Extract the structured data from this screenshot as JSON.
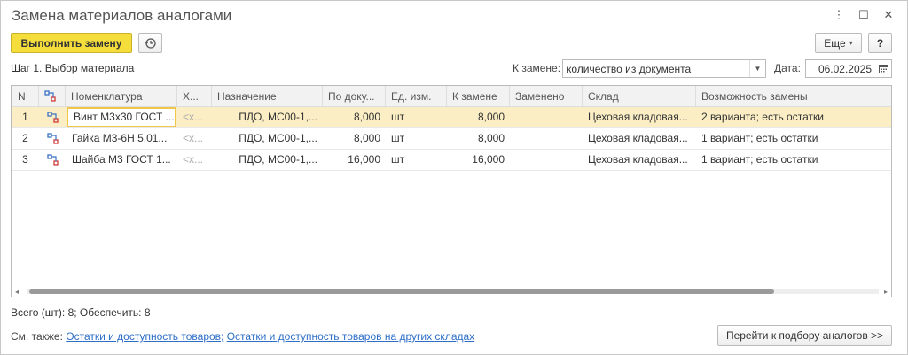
{
  "window": {
    "title": "Замена материалов аналогами",
    "controls": {
      "menu": "⋮",
      "maximize": "☐",
      "close": "✕"
    }
  },
  "toolbar": {
    "execute_label": "Выполнить замену",
    "more_label": "Еще",
    "help_label": "?"
  },
  "step_label": "Шаг 1. Выбор материала",
  "replace": {
    "label": "К замене:",
    "value": "количество из документа"
  },
  "date": {
    "label": "Дата:",
    "value": "06.02.2025"
  },
  "table": {
    "columns": [
      "N",
      "",
      "Номенклатура",
      "Х...",
      "Назначение",
      "По доку...",
      "Ед. изм.",
      "К замене",
      "Заменено",
      "Склад",
      "Возможность замены"
    ],
    "rows": [
      {
        "n": "1",
        "nomenclature": "Винт М3х30 ГОСТ ...",
        "char": "<х...",
        "purpose": "ПДО, МС00-1,...",
        "by_doc": "8,000",
        "unit": "шт",
        "to_replace": "8,000",
        "replaced": "",
        "warehouse": "Цеховая кладовая...",
        "possibility": "2 варианта; есть остатки"
      },
      {
        "n": "2",
        "nomenclature": "Гайка М3-6Н 5.01...",
        "char": "<х...",
        "purpose": "ПДО, МС00-1,...",
        "by_doc": "8,000",
        "unit": "шт",
        "to_replace": "8,000",
        "replaced": "",
        "warehouse": "Цеховая кладовая...",
        "possibility": "1 вариант; есть остатки"
      },
      {
        "n": "3",
        "nomenclature": "Шайба М3 ГОСТ 1...",
        "char": "<х...",
        "purpose": "ПДО, МС00-1,...",
        "by_doc": "16,000",
        "unit": "шт",
        "to_replace": "16,000",
        "replaced": "",
        "warehouse": "Цеховая кладовая...",
        "possibility": "1 вариант; есть остатки"
      }
    ]
  },
  "totals": "Всего (шт): 8; Обеспечить: 8",
  "see_also": {
    "label": "См. также:",
    "link1": "Остатки и доступность товаров;",
    "link2": "Остатки и доступность товаров на других складах"
  },
  "go_button_label": "Перейти к подбору аналогов >>",
  "colors": {
    "accent_yellow": "#f5de3b",
    "selected_row": "#fbeec5",
    "link": "#2d6ec7"
  }
}
